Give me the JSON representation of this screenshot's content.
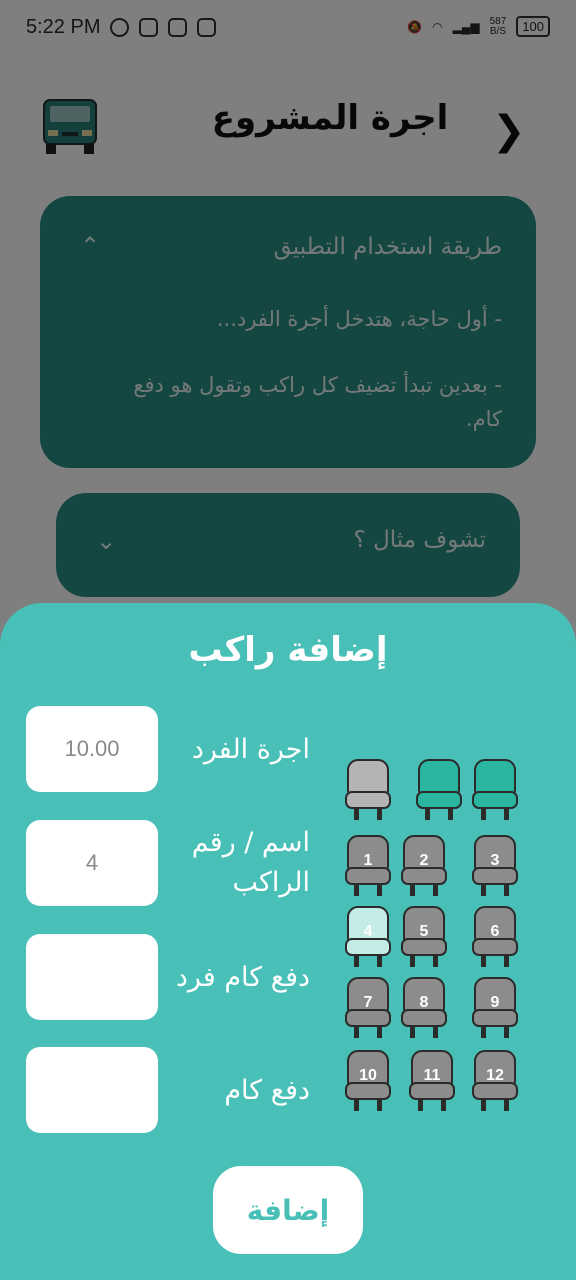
{
  "status_bar": {
    "time": "5:22 PM",
    "net_speed": "587",
    "net_unit": "B/S",
    "battery": "100"
  },
  "header": {
    "title": "اجرة المشروع",
    "back_icon": "chevron-right-icon",
    "logo_icon": "minibus-icon"
  },
  "howto": {
    "title": "طريقة استخدام التطبيق",
    "lines": [
      "- أول حاجة، هتدخل أجرة الفرد...",
      "- بعدين تبدأ تضيف كل راكب وتقول هو دفع كام."
    ]
  },
  "example": {
    "title": "تشوف مثال ؟"
  },
  "sheet": {
    "title": "إضافة راكب",
    "fields": [
      {
        "label": "اجرة الفرد",
        "value": "10.00"
      },
      {
        "label": "اسم / رقم الراكب",
        "value": "4"
      },
      {
        "label": "دفع كام فرد",
        "value": ""
      },
      {
        "label": "دفع كام",
        "value": ""
      }
    ],
    "add_label": "إضافة"
  },
  "seats": [
    {
      "label": "",
      "state": "driver"
    },
    {
      "label": "",
      "state": "front"
    },
    {
      "label": "",
      "state": "front"
    },
    {
      "label": "1",
      "state": "empty"
    },
    {
      "label": "2",
      "state": "empty"
    },
    {
      "label": "3",
      "state": "empty"
    },
    {
      "label": "4",
      "state": "selected"
    },
    {
      "label": "5",
      "state": "empty"
    },
    {
      "label": "6",
      "state": "empty"
    },
    {
      "label": "7",
      "state": "empty"
    },
    {
      "label": "8",
      "state": "empty"
    },
    {
      "label": "9",
      "state": "empty"
    },
    {
      "label": "10",
      "state": "empty"
    },
    {
      "label": "11",
      "state": "empty"
    },
    {
      "label": "12",
      "state": "empty"
    }
  ],
  "colors": {
    "teal_sheet": "#48bfb7",
    "teal_dark": "#2a8f84",
    "seat_empty": "#8c8c8c",
    "seat_driver": "#b4b4b4",
    "seat_front": "#2ab5a0",
    "seat_selected": "#c4ece7"
  }
}
